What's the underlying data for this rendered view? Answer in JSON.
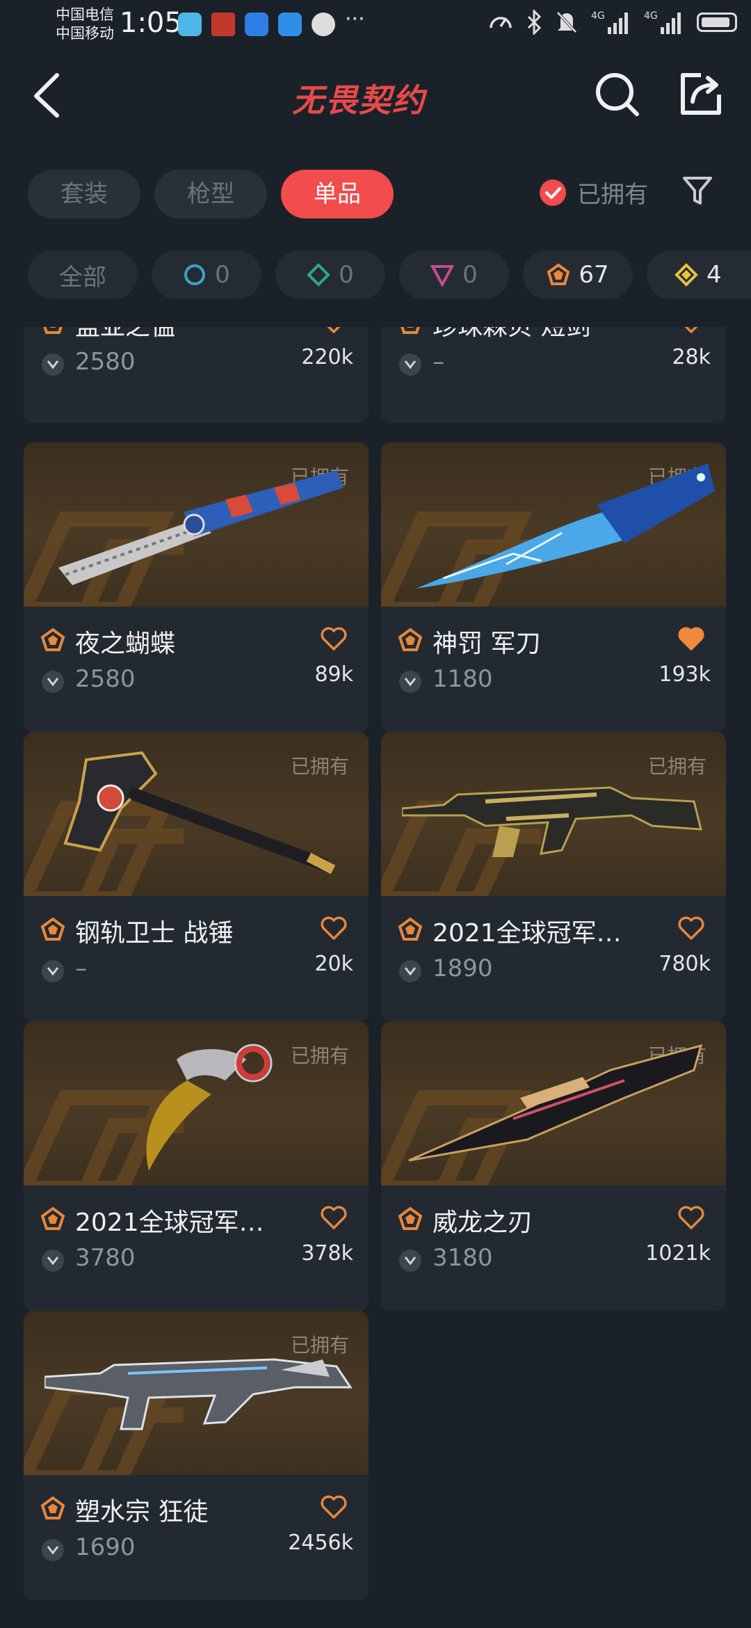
{
  "status_bar": {
    "carrier1": "中国电信",
    "carrier2": "中国移动",
    "time": "1:05",
    "network1": "4G",
    "network2": "4G"
  },
  "header": {
    "title": "无畏契约",
    "brand_color": "#e84a4a"
  },
  "tabs": [
    {
      "label": "套装",
      "active": false
    },
    {
      "label": "枪型",
      "active": false
    },
    {
      "label": "单品",
      "active": true
    }
  ],
  "owned_filter": {
    "label": "已拥有",
    "checked": true
  },
  "tier_chips": [
    {
      "label": "全部",
      "icon": "all"
    },
    {
      "count": "0",
      "icon": "select-tier-icon",
      "color": "#3aa3c9"
    },
    {
      "count": "0",
      "icon": "deluxe-tier-icon",
      "color": "#2aa88f"
    },
    {
      "count": "0",
      "icon": "premium-tier-icon",
      "color": "#c94a8f"
    },
    {
      "count": "67",
      "icon": "exclusive-tier-icon",
      "color": "#e8873a"
    },
    {
      "count": "4",
      "icon": "ultra-tier-icon",
      "color": "#e8c23a"
    }
  ],
  "items": [
    {
      "name": "盖亚之愠",
      "price": "2580",
      "likes": "220k",
      "liked": false,
      "owned_badge": ""
    },
    {
      "name": "珍珠棘贝 短剑",
      "price": "–",
      "likes": "28k",
      "liked": false,
      "owned_badge": ""
    },
    {
      "name": "夜之蝴蝶",
      "price": "2580",
      "likes": "89k",
      "liked": false,
      "owned_badge": "已拥有"
    },
    {
      "name": "神罚 军刀",
      "price": "1180",
      "likes": "193k",
      "liked": true,
      "owned_badge": "已拥有"
    },
    {
      "name": "钢轨卫士 战锤",
      "price": "–",
      "likes": "20k",
      "liked": false,
      "owned_badge": "已拥有"
    },
    {
      "name": "2021全球冠军…",
      "price": "1890",
      "likes": "780k",
      "liked": false,
      "owned_badge": "已拥有"
    },
    {
      "name": "2021全球冠军…",
      "price": "3780",
      "likes": "378k",
      "liked": false,
      "owned_badge": "已拥有"
    },
    {
      "name": "威龙之刃",
      "price": "3180",
      "likes": "1021k",
      "liked": false,
      "owned_badge": "已拥有"
    },
    {
      "name": "塑水宗 狂徒",
      "price": "1690",
      "likes": "2456k",
      "liked": false,
      "owned_badge": "已拥有"
    }
  ]
}
